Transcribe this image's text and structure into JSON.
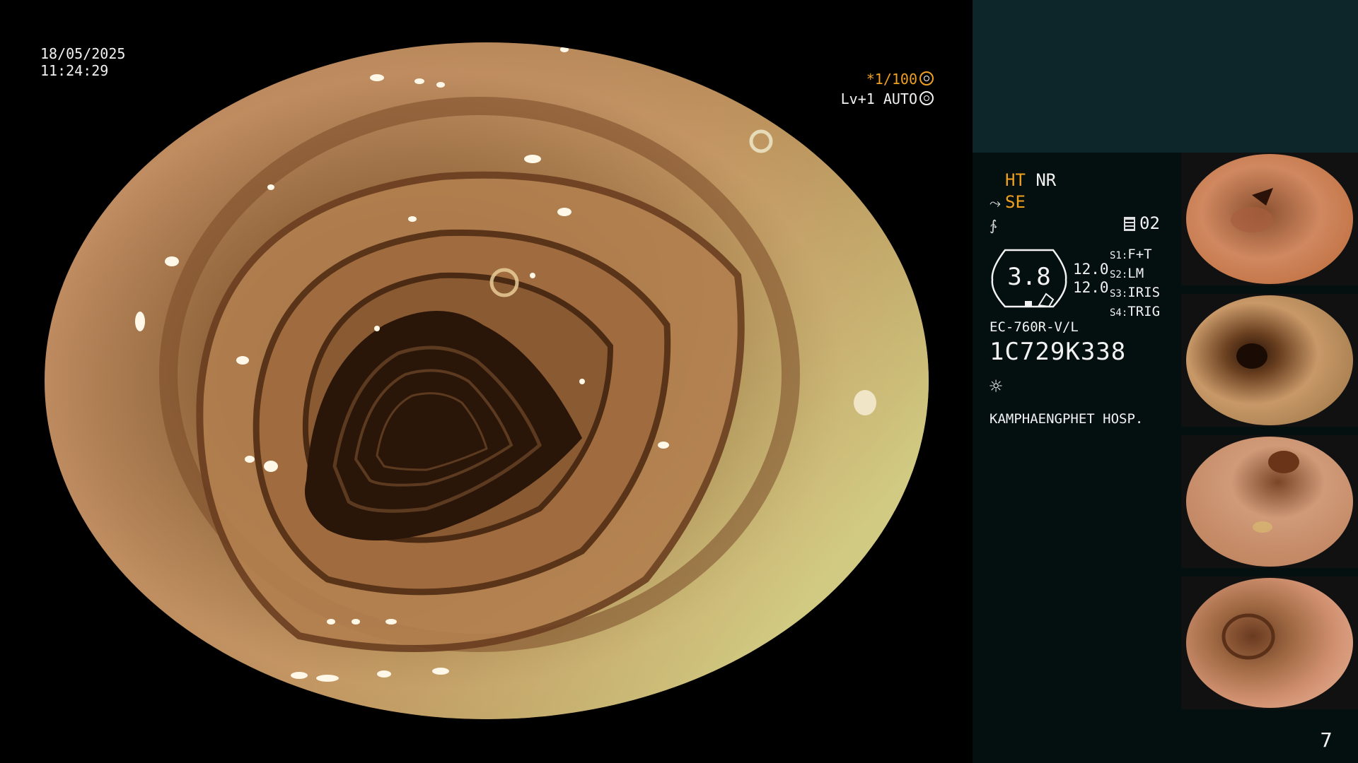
{
  "overlay": {
    "date": "18/05/2025",
    "time": "11:24:29",
    "shutter": "*1/100",
    "level": "Lv+1 AUTO"
  },
  "panel": {
    "mode_ht": "HT",
    "mode_nr": "NR",
    "mode_se": "SE",
    "counter": "02",
    "gauge_value": "3.8",
    "side_top": "12.0",
    "side_bottom": "12.0",
    "switches": [
      {
        "key": "S1:",
        "value": "F+T"
      },
      {
        "key": "S2:",
        "value": "LM"
      },
      {
        "key": "S3:",
        "value": "IRIS"
      },
      {
        "key": "S4:",
        "value": "TRIG"
      }
    ],
    "scope_model": "EC-760R-V/L",
    "scope_serial": "1C729K338",
    "hospital": "KAMPHAENGPHET HOSP.",
    "page_number": "7"
  },
  "icons": {
    "shutter": "aperture-icon",
    "level": "iris-icon",
    "se": "structure-icon",
    "cut": "color-icon",
    "counter": "document-icon",
    "light": "light-icon"
  },
  "colors": {
    "accent": "#f0a020",
    "panel_bg": "#04100f",
    "panel_top": "#0d2629"
  },
  "thumbnails": [
    {
      "label": "captured-image-1"
    },
    {
      "label": "captured-image-2"
    },
    {
      "label": "captured-image-3"
    },
    {
      "label": "captured-image-4"
    }
  ]
}
